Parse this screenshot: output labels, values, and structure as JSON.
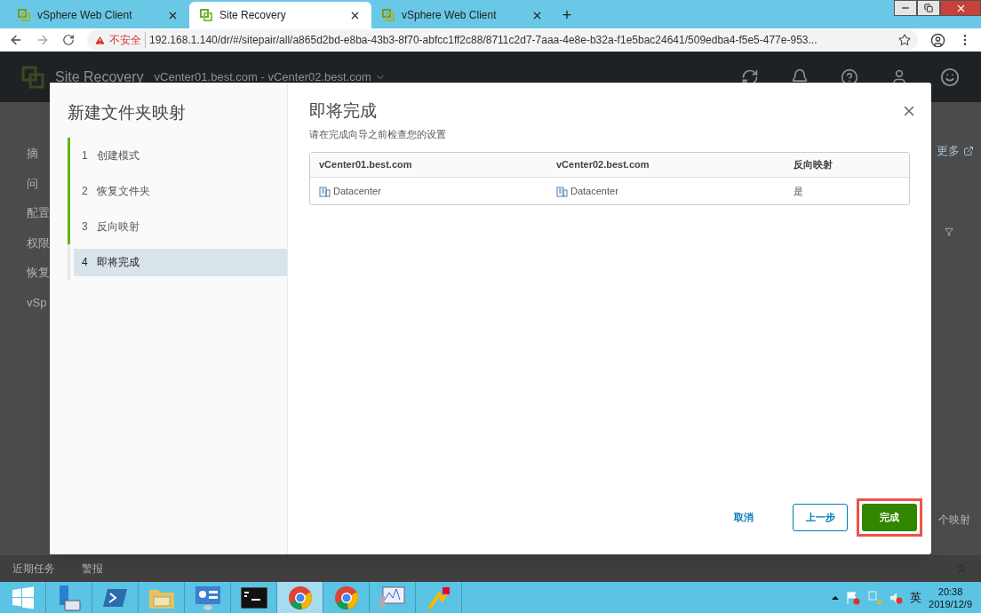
{
  "browser": {
    "tabs": [
      {
        "title": "vSphere Web Client",
        "selected": false
      },
      {
        "title": "Site Recovery",
        "selected": true
      },
      {
        "title": "vSphere Web Client",
        "selected": false
      }
    ],
    "new_tab": "+",
    "address": {
      "warning": "不安全",
      "url": "192.168.1.140/dr/#/sitepair/all/a865d2bd-e8ba-43b3-8f70-abfcc1ff2c88/8711c2d7-7aaa-4e8e-b32a-f1e5bac24641/509edba4-f5e5-477e-953..."
    }
  },
  "app": {
    "title": "Site Recovery",
    "context": "vCenter01.best.com - vCenter02.best.com",
    "nav": [
      "摘",
      "问",
      "配置",
      "权限",
      "恢复",
      "vSp"
    ],
    "more_link": "更多",
    "panel_text": "个映射"
  },
  "dialog": {
    "title": "新建文件夹映射",
    "steps": [
      {
        "number": "1",
        "label": "创建模式",
        "completed": true,
        "selected": false
      },
      {
        "number": "2",
        "label": "恢复文件夹",
        "completed": true,
        "selected": false
      },
      {
        "number": "3",
        "label": "反向映射",
        "completed": true,
        "selected": false
      },
      {
        "number": "4",
        "label": "即将完成",
        "completed": false,
        "selected": true
      }
    ],
    "heading": "即将完成",
    "subtitle": "请在完成向导之前检查您的设置",
    "table": {
      "columns": [
        "vCenter01.best.com",
        "vCenter02.best.com",
        "反向映射"
      ],
      "rows": [
        [
          {
            "kind": "datacenter",
            "text": "Datacenter"
          },
          {
            "kind": "datacenter",
            "text": "Datacenter"
          },
          {
            "kind": "text",
            "text": "是"
          }
        ]
      ]
    },
    "buttons": [
      {
        "kind": "link",
        "label": "取消"
      },
      {
        "kind": "outline",
        "label": "上一步"
      },
      {
        "kind": "primary",
        "label": "完成",
        "highlighted": true
      }
    ]
  },
  "bottom_tabs": [
    "近期任务",
    "警报"
  ],
  "taskbar": {
    "apps": [
      {
        "kind": "start",
        "selected": false
      },
      {
        "kind": "server",
        "selected": false
      },
      {
        "kind": "powershell",
        "selected": false
      },
      {
        "kind": "folder",
        "selected": false
      },
      {
        "kind": "panel",
        "selected": false
      },
      {
        "kind": "terminal",
        "selected": false
      },
      {
        "kind": "chrome",
        "selected": true
      },
      {
        "kind": "chrome",
        "selected": false
      },
      {
        "kind": "monitor",
        "selected": false
      },
      {
        "kind": "arrow",
        "selected": false
      }
    ],
    "ime": "英",
    "time": "20:38",
    "date": "2019/12/9"
  }
}
